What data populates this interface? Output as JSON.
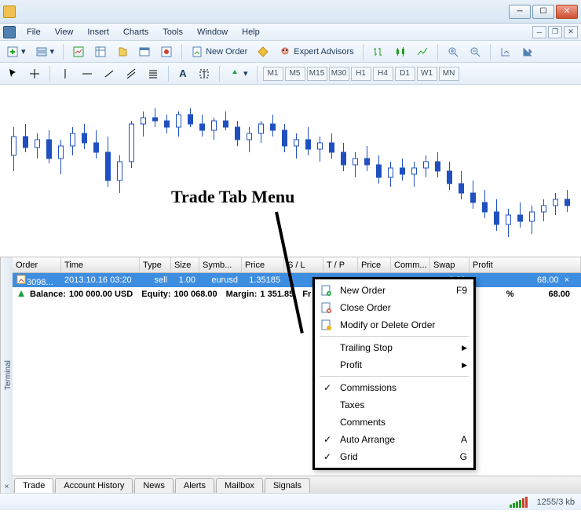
{
  "window": {
    "title": ""
  },
  "menu": [
    "File",
    "View",
    "Insert",
    "Charts",
    "Tools",
    "Window",
    "Help"
  ],
  "toolbar1": {
    "new_order": "New Order",
    "expert_advisors": "Expert Advisors"
  },
  "timeframes": [
    "M1",
    "M5",
    "M15",
    "M30",
    "H1",
    "H4",
    "D1",
    "W1",
    "MN"
  ],
  "annotation": "Trade Tab Menu",
  "terminal": {
    "side_label": "Terminal",
    "columns": [
      "Order",
      "Time",
      "Type",
      "Size",
      "Symb...",
      "Price",
      "S / L",
      "T / P",
      "Price",
      "Comm...",
      "Swap",
      "Profit"
    ],
    "row": {
      "order": "3098...",
      "time": "2013.10.16 03:20",
      "type": "sell",
      "size": "1.00",
      "symbol": "eurusd",
      "price": "1.35185",
      "sl": "",
      "tp": "",
      "price2": "",
      "comm": "",
      "swap": "0.00",
      "profit": "68.00"
    },
    "balance_row": {
      "balance_lbl": "Balance:",
      "balance_val": "100 000.00 USD",
      "equity_lbl": "Equity:",
      "equity_val": "100 068.00",
      "margin_lbl": "Margin:",
      "margin_val": "1 351.85",
      "free_lbl": "Fr",
      "pct": "%",
      "profit": "68.00"
    },
    "tabs": [
      "Trade",
      "Account History",
      "News",
      "Alerts",
      "Mailbox",
      "Signals"
    ]
  },
  "context_menu": {
    "new_order": "New Order",
    "new_order_key": "F9",
    "close_order": "Close Order",
    "modify": "Modify or Delete Order",
    "trailing": "Trailing Stop",
    "profit": "Profit",
    "commissions": "Commissions",
    "taxes": "Taxes",
    "comments": "Comments",
    "auto_arrange": "Auto Arrange",
    "auto_key": "A",
    "grid": "Grid",
    "grid_key": "G"
  },
  "status": {
    "conn": "1255/3 kb"
  },
  "chart_data": {
    "type": "candlestick",
    "note": "approximate OHLC read from gridless candlestick chart; values are relative in [0,1] of visible y-range",
    "candles": [
      {
        "o": 0.6,
        "h": 0.78,
        "l": 0.5,
        "c": 0.72,
        "dir": "up"
      },
      {
        "o": 0.72,
        "h": 0.8,
        "l": 0.62,
        "c": 0.65,
        "dir": "down"
      },
      {
        "o": 0.65,
        "h": 0.74,
        "l": 0.58,
        "c": 0.7,
        "dir": "up"
      },
      {
        "o": 0.7,
        "h": 0.76,
        "l": 0.55,
        "c": 0.58,
        "dir": "down"
      },
      {
        "o": 0.58,
        "h": 0.7,
        "l": 0.48,
        "c": 0.66,
        "dir": "up"
      },
      {
        "o": 0.66,
        "h": 0.78,
        "l": 0.6,
        "c": 0.74,
        "dir": "up"
      },
      {
        "o": 0.74,
        "h": 0.8,
        "l": 0.64,
        "c": 0.68,
        "dir": "down"
      },
      {
        "o": 0.68,
        "h": 0.76,
        "l": 0.58,
        "c": 0.62,
        "dir": "down"
      },
      {
        "o": 0.62,
        "h": 0.72,
        "l": 0.4,
        "c": 0.44,
        "dir": "down"
      },
      {
        "o": 0.44,
        "h": 0.6,
        "l": 0.36,
        "c": 0.56,
        "dir": "up"
      },
      {
        "o": 0.56,
        "h": 0.82,
        "l": 0.52,
        "c": 0.8,
        "dir": "up"
      },
      {
        "o": 0.8,
        "h": 0.88,
        "l": 0.72,
        "c": 0.84,
        "dir": "up"
      },
      {
        "o": 0.84,
        "h": 0.9,
        "l": 0.78,
        "c": 0.82,
        "dir": "down"
      },
      {
        "o": 0.82,
        "h": 0.86,
        "l": 0.74,
        "c": 0.78,
        "dir": "down"
      },
      {
        "o": 0.78,
        "h": 0.88,
        "l": 0.72,
        "c": 0.86,
        "dir": "up"
      },
      {
        "o": 0.86,
        "h": 0.9,
        "l": 0.78,
        "c": 0.8,
        "dir": "down"
      },
      {
        "o": 0.8,
        "h": 0.86,
        "l": 0.72,
        "c": 0.76,
        "dir": "down"
      },
      {
        "o": 0.76,
        "h": 0.84,
        "l": 0.7,
        "c": 0.82,
        "dir": "up"
      },
      {
        "o": 0.82,
        "h": 0.88,
        "l": 0.76,
        "c": 0.78,
        "dir": "down"
      },
      {
        "o": 0.78,
        "h": 0.82,
        "l": 0.66,
        "c": 0.7,
        "dir": "down"
      },
      {
        "o": 0.7,
        "h": 0.78,
        "l": 0.62,
        "c": 0.74,
        "dir": "up"
      },
      {
        "o": 0.74,
        "h": 0.82,
        "l": 0.68,
        "c": 0.8,
        "dir": "up"
      },
      {
        "o": 0.8,
        "h": 0.86,
        "l": 0.72,
        "c": 0.76,
        "dir": "down"
      },
      {
        "o": 0.76,
        "h": 0.8,
        "l": 0.62,
        "c": 0.66,
        "dir": "down"
      },
      {
        "o": 0.66,
        "h": 0.74,
        "l": 0.58,
        "c": 0.7,
        "dir": "up"
      },
      {
        "o": 0.7,
        "h": 0.78,
        "l": 0.6,
        "c": 0.64,
        "dir": "down"
      },
      {
        "o": 0.64,
        "h": 0.72,
        "l": 0.56,
        "c": 0.68,
        "dir": "up"
      },
      {
        "o": 0.68,
        "h": 0.74,
        "l": 0.58,
        "c": 0.62,
        "dir": "down"
      },
      {
        "o": 0.62,
        "h": 0.68,
        "l": 0.5,
        "c": 0.54,
        "dir": "down"
      },
      {
        "o": 0.54,
        "h": 0.62,
        "l": 0.46,
        "c": 0.58,
        "dir": "up"
      },
      {
        "o": 0.58,
        "h": 0.66,
        "l": 0.5,
        "c": 0.54,
        "dir": "down"
      },
      {
        "o": 0.54,
        "h": 0.6,
        "l": 0.42,
        "c": 0.46,
        "dir": "down"
      },
      {
        "o": 0.46,
        "h": 0.56,
        "l": 0.4,
        "c": 0.52,
        "dir": "up"
      },
      {
        "o": 0.52,
        "h": 0.58,
        "l": 0.44,
        "c": 0.48,
        "dir": "down"
      },
      {
        "o": 0.48,
        "h": 0.56,
        "l": 0.4,
        "c": 0.52,
        "dir": "up"
      },
      {
        "o": 0.52,
        "h": 0.6,
        "l": 0.46,
        "c": 0.56,
        "dir": "up"
      },
      {
        "o": 0.56,
        "h": 0.62,
        "l": 0.46,
        "c": 0.5,
        "dir": "down"
      },
      {
        "o": 0.5,
        "h": 0.56,
        "l": 0.38,
        "c": 0.42,
        "dir": "down"
      },
      {
        "o": 0.42,
        "h": 0.5,
        "l": 0.32,
        "c": 0.36,
        "dir": "down"
      },
      {
        "o": 0.36,
        "h": 0.44,
        "l": 0.26,
        "c": 0.3,
        "dir": "down"
      },
      {
        "o": 0.3,
        "h": 0.38,
        "l": 0.2,
        "c": 0.24,
        "dir": "down"
      },
      {
        "o": 0.24,
        "h": 0.32,
        "l": 0.12,
        "c": 0.16,
        "dir": "down"
      },
      {
        "o": 0.16,
        "h": 0.26,
        "l": 0.08,
        "c": 0.22,
        "dir": "up"
      },
      {
        "o": 0.22,
        "h": 0.3,
        "l": 0.14,
        "c": 0.18,
        "dir": "down"
      },
      {
        "o": 0.18,
        "h": 0.28,
        "l": 0.1,
        "c": 0.24,
        "dir": "up"
      },
      {
        "o": 0.24,
        "h": 0.32,
        "l": 0.18,
        "c": 0.28,
        "dir": "up"
      },
      {
        "o": 0.28,
        "h": 0.36,
        "l": 0.22,
        "c": 0.32,
        "dir": "up"
      },
      {
        "o": 0.32,
        "h": 0.38,
        "l": 0.24,
        "c": 0.28,
        "dir": "down"
      }
    ]
  }
}
